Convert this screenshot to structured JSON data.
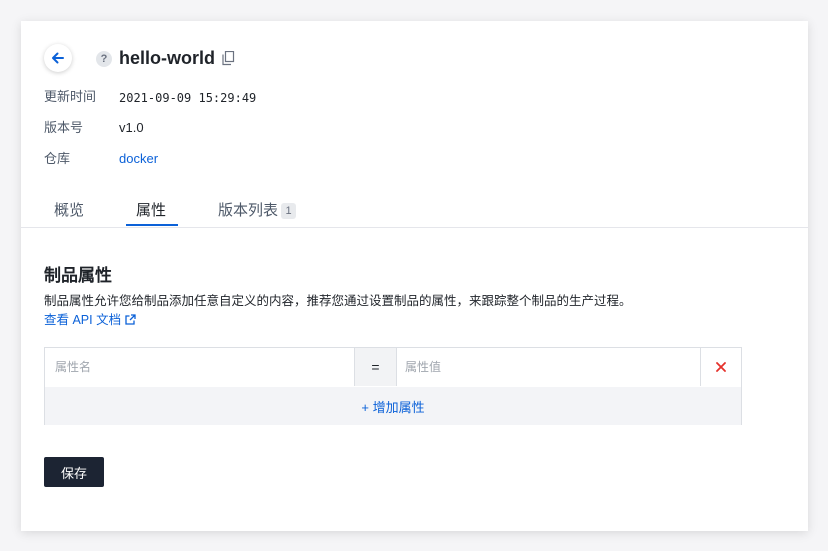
{
  "header": {
    "title": "hello-world",
    "help_icon": "help-icon",
    "help_glyph": "?",
    "back_icon": "arrow-left-icon",
    "copy_icon": "copy-icon"
  },
  "meta": [
    {
      "label": "更新时间",
      "value": "2021-09-09 15:29:49"
    },
    {
      "label": "版本号",
      "value": "v1.0"
    },
    {
      "label": "仓库",
      "value": "docker"
    }
  ],
  "tabs": [
    {
      "label": "概览",
      "active": false
    },
    {
      "label": "属性",
      "active": true
    },
    {
      "label": "版本列表",
      "badge": "1",
      "active": false
    }
  ],
  "section": {
    "title": "制品属性",
    "description": "制品属性允许您给制品添加任意自定义的内容，推荐您通过设置制品的属性，来跟踪整个制品的生产过程。",
    "doc_link": "查看 API 文档"
  },
  "property_table": {
    "name_placeholder": "属性名",
    "value_placeholder": "属性值",
    "name_value": "",
    "value_value": "",
    "separator": "=",
    "delete_icon": "close-icon",
    "add_label": "+ 增加属性"
  },
  "actions": {
    "save_label": "保存"
  },
  "colors": {
    "accent": "#0b61d8",
    "danger": "#e5312b",
    "save_button": "#1c2433"
  }
}
